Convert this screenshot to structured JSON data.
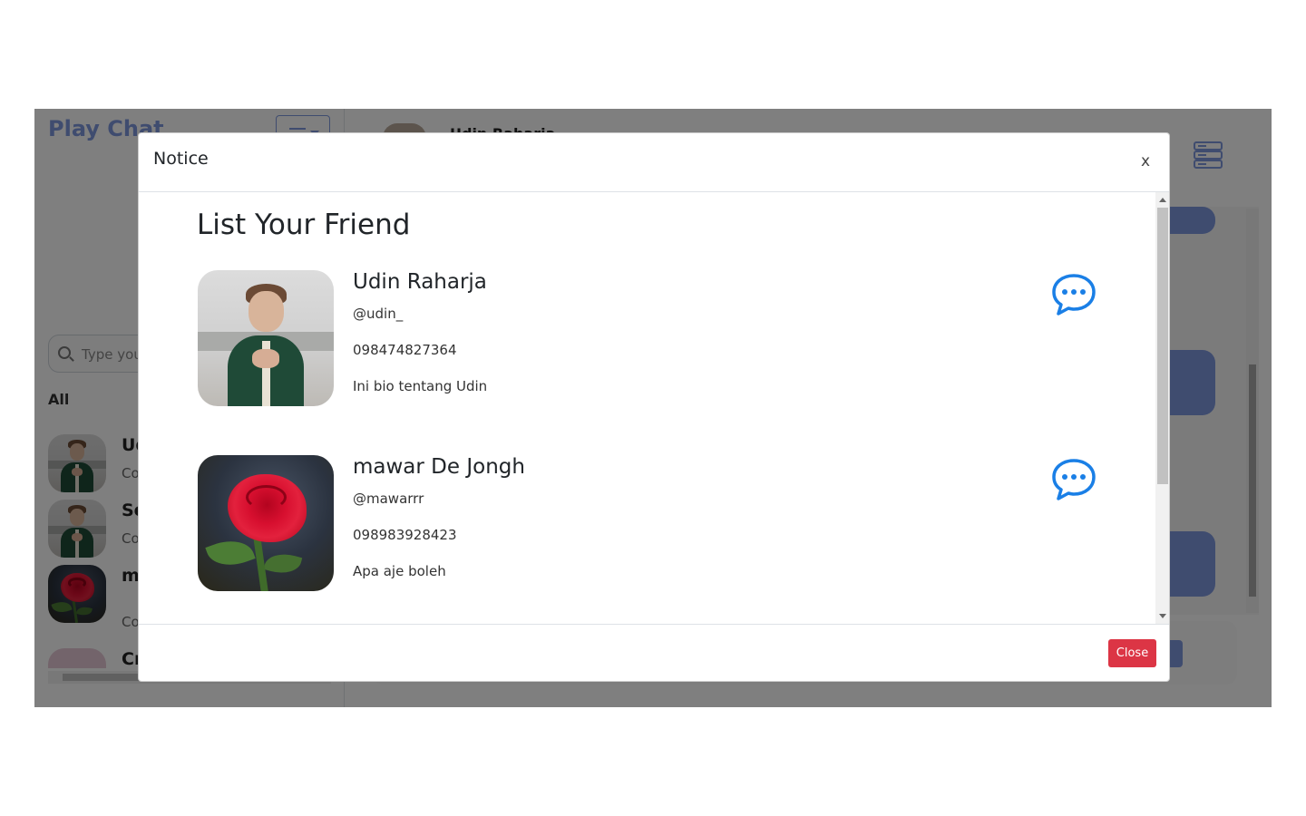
{
  "app": {
    "brand": "Play Chat",
    "search_placeholder": "Type your message...",
    "search_visible_text": "Type you",
    "tab_all": "All",
    "contacts": [
      {
        "name": "Ud",
        "preview": "Co"
      },
      {
        "name": "Se",
        "preview": "Co"
      },
      {
        "name": "m Jo",
        "preview": "Co"
      },
      {
        "name": "Cr",
        "preview": ""
      }
    ],
    "chat_header_name": "Udin Raharja"
  },
  "modal": {
    "title": "Notice",
    "close_x": "x",
    "heading": "List Your Friend",
    "friends": [
      {
        "name": "Udin Raharja",
        "username": "@udin_",
        "phone": "098474827364",
        "bio": "Ini bio tentang Udin",
        "photo": "man-portrait"
      },
      {
        "name": "mawar De Jongh",
        "username": "@mawarrr",
        "phone": "098983928423",
        "bio": "Apa aje boleh",
        "photo": "red-rose"
      }
    ],
    "footer_close": "Close"
  },
  "colors": {
    "accent": "#7e98df",
    "chat_icon": "#1a7fe6",
    "danger": "#dc3545",
    "overlay": "rgba(0,0,0,0.5)"
  },
  "icons": {
    "menu": "hamburger-menu-icon",
    "search": "search-icon",
    "server": "server-icon",
    "chat": "chat-bubble-dots-icon"
  }
}
